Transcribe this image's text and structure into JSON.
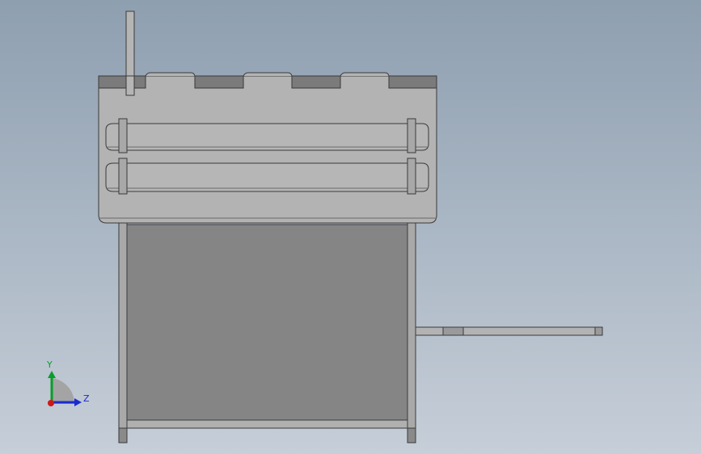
{
  "triad": {
    "y_label": "Y",
    "z_label": "Z",
    "colors": {
      "y": "#0a9d2a",
      "z": "#1a2bd1",
      "x": "#d01717"
    }
  },
  "colors": {
    "background_top": "#8e9fb0",
    "background_bottom": "#c3ccd6",
    "part_fill": "#b3b3b3",
    "dark_face": "#808080",
    "edge": "#3a3a3a"
  }
}
